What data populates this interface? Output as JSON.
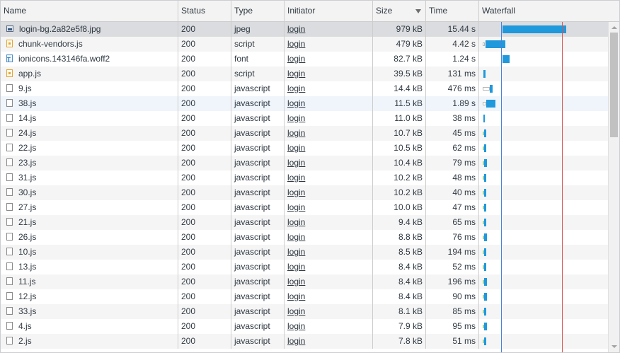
{
  "columns": {
    "name": "Name",
    "status": "Status",
    "type": "Type",
    "initiator": "Initiator",
    "size": "Size",
    "time": "Time",
    "waterfall": "Waterfall"
  },
  "sort": {
    "column": "size",
    "direction": "descending"
  },
  "colors": {
    "bar": "#1f98dc",
    "dom_content_loaded_line": "#4a7fde",
    "load_line": "#d9534f",
    "selected_row": "#dadcdf"
  },
  "requests": [
    {
      "name": "login-bg.2a82e5f8.jpg",
      "icon": "image-file-icon",
      "status": "200",
      "type": "jpeg",
      "initiator": "login",
      "size": "979 kB",
      "time": "15.44 s",
      "row_state": "selected"
    },
    {
      "name": "chunk-vendors.js",
      "icon": "script-file-icon",
      "status": "200",
      "type": "script",
      "initiator": "login",
      "size": "479 kB",
      "time": "4.42 s"
    },
    {
      "name": "ionicons.143146fa.woff2",
      "icon": "font-file-icon",
      "status": "200",
      "type": "font",
      "initiator": "login",
      "size": "82.7 kB",
      "time": "1.24 s"
    },
    {
      "name": "app.js",
      "icon": "script-file-icon",
      "status": "200",
      "type": "script",
      "initiator": "login",
      "size": "39.5 kB",
      "time": "131 ms"
    },
    {
      "name": "9.js",
      "icon": "document-file-icon",
      "status": "200",
      "type": "javascript",
      "initiator": "login",
      "size": "14.4 kB",
      "time": "476 ms"
    },
    {
      "name": "38.js",
      "icon": "document-file-icon",
      "status": "200",
      "type": "javascript",
      "initiator": "login",
      "size": "11.5 kB",
      "time": "1.89 s",
      "row_state": "hover"
    },
    {
      "name": "14.js",
      "icon": "document-file-icon",
      "status": "200",
      "type": "javascript",
      "initiator": "login",
      "size": "11.0 kB",
      "time": "38 ms"
    },
    {
      "name": "24.js",
      "icon": "document-file-icon",
      "status": "200",
      "type": "javascript",
      "initiator": "login",
      "size": "10.7 kB",
      "time": "45 ms"
    },
    {
      "name": "22.js",
      "icon": "document-file-icon",
      "status": "200",
      "type": "javascript",
      "initiator": "login",
      "size": "10.5 kB",
      "time": "62 ms"
    },
    {
      "name": "23.js",
      "icon": "document-file-icon",
      "status": "200",
      "type": "javascript",
      "initiator": "login",
      "size": "10.4 kB",
      "time": "79 ms"
    },
    {
      "name": "31.js",
      "icon": "document-file-icon",
      "status": "200",
      "type": "javascript",
      "initiator": "login",
      "size": "10.2 kB",
      "time": "48 ms"
    },
    {
      "name": "30.js",
      "icon": "document-file-icon",
      "status": "200",
      "type": "javascript",
      "initiator": "login",
      "size": "10.2 kB",
      "time": "40 ms"
    },
    {
      "name": "27.js",
      "icon": "document-file-icon",
      "status": "200",
      "type": "javascript",
      "initiator": "login",
      "size": "10.0 kB",
      "time": "47 ms"
    },
    {
      "name": "21.js",
      "icon": "document-file-icon",
      "status": "200",
      "type": "javascript",
      "initiator": "login",
      "size": "9.4 kB",
      "time": "65 ms"
    },
    {
      "name": "26.js",
      "icon": "document-file-icon",
      "status": "200",
      "type": "javascript",
      "initiator": "login",
      "size": "8.8 kB",
      "time": "76 ms"
    },
    {
      "name": "10.js",
      "icon": "document-file-icon",
      "status": "200",
      "type": "javascript",
      "initiator": "login",
      "size": "8.5 kB",
      "time": "194 ms"
    },
    {
      "name": "13.js",
      "icon": "document-file-icon",
      "status": "200",
      "type": "javascript",
      "initiator": "login",
      "size": "8.4 kB",
      "time": "52 ms"
    },
    {
      "name": "11.js",
      "icon": "document-file-icon",
      "status": "200",
      "type": "javascript",
      "initiator": "login",
      "size": "8.4 kB",
      "time": "196 ms"
    },
    {
      "name": "12.js",
      "icon": "document-file-icon",
      "status": "200",
      "type": "javascript",
      "initiator": "login",
      "size": "8.4 kB",
      "time": "90 ms"
    },
    {
      "name": "33.js",
      "icon": "document-file-icon",
      "status": "200",
      "type": "javascript",
      "initiator": "login",
      "size": "8.1 kB",
      "time": "85 ms"
    },
    {
      "name": "4.js",
      "icon": "document-file-icon",
      "status": "200",
      "type": "javascript",
      "initiator": "login",
      "size": "7.9 kB",
      "time": "95 ms"
    },
    {
      "name": "2.js",
      "icon": "document-file-icon",
      "status": "200",
      "type": "javascript",
      "initiator": "login",
      "size": "7.8 kB",
      "time": "51 ms"
    }
  ]
}
